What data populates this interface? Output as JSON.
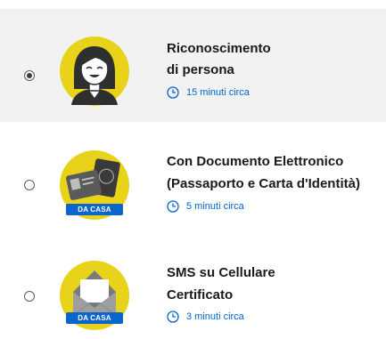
{
  "options": [
    {
      "title_line1": "Riconoscimento",
      "title_line2": "di persona",
      "time": "15 minuti circa",
      "selected": true,
      "icon": "person-icon"
    },
    {
      "title_line1": "Con Documento Elettronico",
      "title_line2": "(Passaporto e Carta d'Identità)",
      "time": "5 minuti circa",
      "badge": "DA CASA",
      "selected": false,
      "icon": "passport-id-card-icon"
    },
    {
      "title_line1": "SMS su Cellulare",
      "title_line2": "Certificato",
      "time": "3 minuti circa",
      "badge": "DA CASA",
      "selected": false,
      "icon": "envelope-icon"
    }
  ],
  "colors": {
    "accent": "#0066cc",
    "illustration_bg": "#e8d21a",
    "selected_row_bg": "#f2f2f2"
  }
}
